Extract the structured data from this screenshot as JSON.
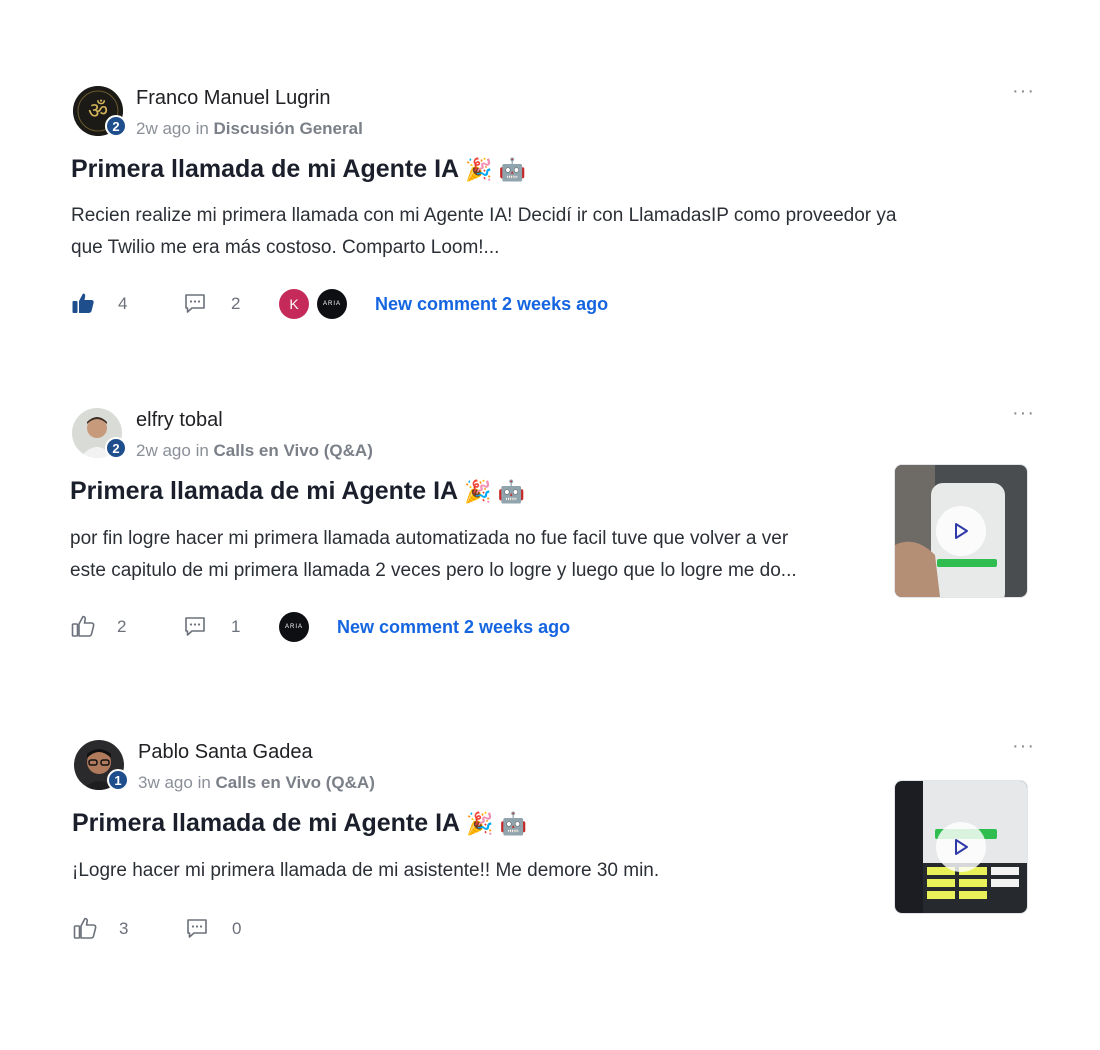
{
  "colors": {
    "accent": "#1565e0",
    "level_badge": "#1f4e8c"
  },
  "posts": [
    {
      "author": "Franco Manuel Lugrin",
      "level": "2",
      "time": "2w ago",
      "in": "in",
      "category": "Discusión General",
      "title": "Primera llamada de mi Agente IA",
      "title_emojis": "🎉 🤖",
      "body_line1": "Recien realize mi primera llamada con mi Agente IA! Decidí ir con LlamadasIP como proveedor ya",
      "body_line2": "que Twilio me era más costoso. Comparto Loom!...",
      "likes": "4",
      "comments": "2",
      "liked": true,
      "commenters": [
        "K",
        "ARIA"
      ],
      "new_comment": "New comment 2 weeks ago",
      "menu": "···",
      "avatar_icon": "om-symbol-icon"
    },
    {
      "author": "elfry tobal",
      "level": "2",
      "time": "2w ago",
      "in": "in",
      "category": "Calls en Vivo (Q&A)",
      "title": "Primera llamada de mi Agente IA",
      "title_emojis": "🎉 🤖",
      "body_line1": "por fin logre hacer mi primera llamada automatizada no fue facil tuve que volver a ver",
      "body_line2": "este capitulo de mi primera llamada 2 veces pero lo logre y luego que lo logre me do...",
      "likes": "2",
      "comments": "1",
      "liked": false,
      "commenters": [
        "ARIA"
      ],
      "new_comment": "New comment 2 weeks ago",
      "menu": "···",
      "video_icon": "play-icon"
    },
    {
      "author": "Pablo Santa Gadea",
      "level": "1",
      "time": "3w ago",
      "in": "in",
      "category": "Calls en Vivo (Q&A)",
      "title": "Primera llamada de mi Agente IA",
      "title_emojis": "🎉 🤖",
      "body_line1": "¡Logre hacer mi primera llamada de mi asistente!! Me demore 30 min.",
      "likes": "3",
      "comments": "0",
      "liked": false,
      "menu": "···",
      "video_icon": "play-icon"
    }
  ]
}
